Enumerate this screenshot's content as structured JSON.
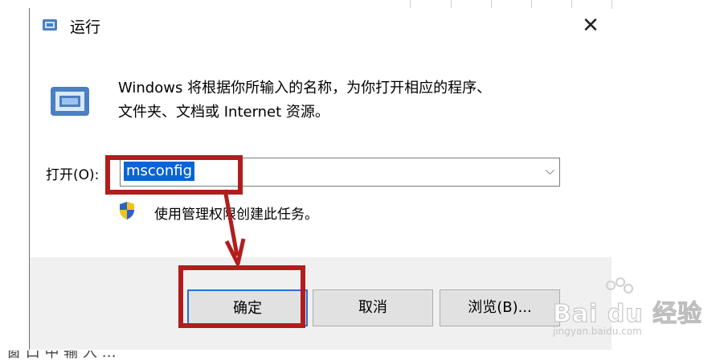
{
  "dialog": {
    "title": "运行",
    "close_glyph": "✕",
    "description_line1": "Windows 将根据你所输入的名称，为你打开相应的程序、",
    "description_line2": "文件夹、文档或 Internet 资源。",
    "open_label": "打开(O):",
    "open_value": "msconfig",
    "dropdown_glyph": "⌵",
    "admin_note": "使用管理权限创建此任务。",
    "buttons": {
      "ok": "确定",
      "cancel": "取消",
      "browse": "浏览(B)..."
    },
    "icons": {
      "title": "run-icon",
      "large": "run-icon",
      "admin": "shield-icon",
      "close": "close-icon",
      "dropdown": "chevron-down-icon"
    }
  },
  "background": {
    "bottom_text": "窗 口 中 输 入 …"
  },
  "annotations": {
    "highlight_color": "#b11d1d"
  },
  "watermark": {
    "main": "Bai du 经验",
    "sub": "jingyan.baidu.com"
  }
}
